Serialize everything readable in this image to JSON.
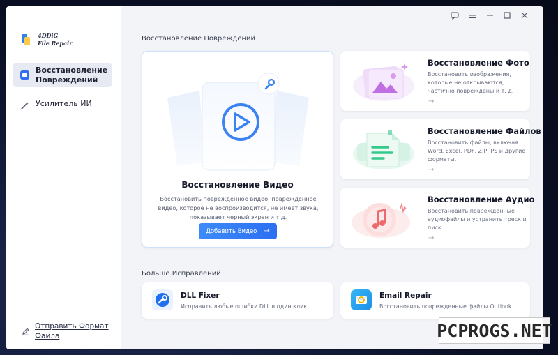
{
  "app": {
    "logo_line1": "4DDiG",
    "logo_line2": "File Repair"
  },
  "sidebar": {
    "items": [
      {
        "label": "Восстановление Повреждений",
        "active": true,
        "icon": "folder-icon"
      },
      {
        "label": "Усилитель ИИ",
        "active": false,
        "icon": "magic-wand-icon"
      }
    ],
    "footer_link": "Отправить Формат Файла",
    "footer_icon": "pencil-icon"
  },
  "window_controls": [
    "feedback-icon",
    "menu-icon",
    "minimize-icon",
    "maximize-icon",
    "close-icon"
  ],
  "repair_section": {
    "title": "Восстановление Повреждений",
    "video_card": {
      "title": "Восстановление Видео",
      "description": "Восстановить поврежденное видео, поврежденное видео, которое не воспроизводится, не имеет звука, показывает черный экран и т.д.",
      "button_label": "Добавить Видео",
      "button_arrow": "→"
    },
    "cards": [
      {
        "title": "Восстановление Фото",
        "description": "Восстановить изображения, которые не открываются, частично повреждены и т. д.",
        "arrow": "→",
        "icon": "photo-icon",
        "accent": "#c77de6"
      },
      {
        "title": "Восстановление Файлов",
        "description": "Восстановить файлы, включая Word, Excel, PDF, ZIP, PS и другие форматы.",
        "arrow": "→",
        "icon": "document-icon",
        "accent": "#33c98a"
      },
      {
        "title": "Восстановление Аудио",
        "description": "Восстановить поврежденные аудиофайлы и устранить треск и писк.",
        "arrow": "→",
        "icon": "music-note-icon",
        "accent": "#f16a6a"
      }
    ]
  },
  "more_section": {
    "title": "Больше Исправлений",
    "items": [
      {
        "title": "DLL Fixer",
        "description": "Исправить любые ошибки DLL в один клик",
        "icon": "dll-fixer-icon",
        "accent": "#1f6ff0"
      },
      {
        "title": "Email Repair",
        "description": "Восстановить поврежденные файлы Outlook",
        "icon": "email-repair-icon",
        "accent": "#1ea3f0"
      }
    ]
  },
  "watermark": "PCPROGS.NET"
}
